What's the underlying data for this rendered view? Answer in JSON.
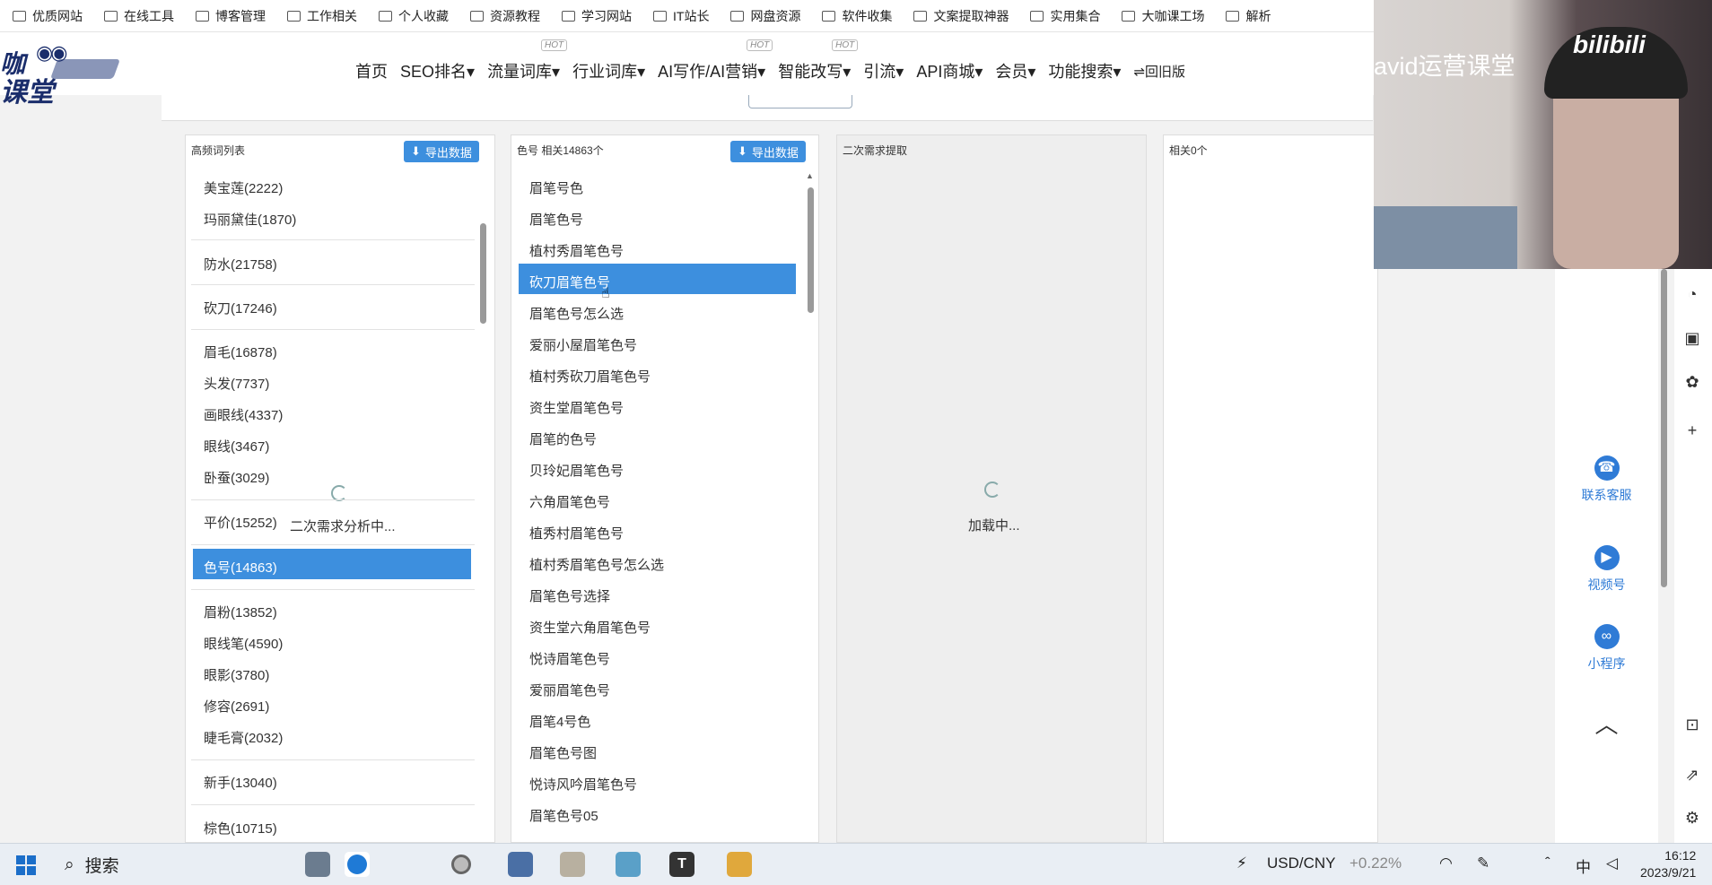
{
  "bookmarks": [
    "优质网站",
    "在线工具",
    "博客管理",
    "工作相关",
    "个人收藏",
    "资源教程",
    "学习网站",
    "IT站长",
    "网盘资源",
    "软件收集",
    "文案提取神器",
    "实用集合",
    "大咖课工场",
    "解析"
  ],
  "logo": {
    "line1": "咖",
    "line2": "课堂"
  },
  "nav": {
    "items": [
      "首页",
      "SEO排名▾",
      "流量词库▾",
      "行业词库▾",
      "AI写作/AI营销▾",
      "智能改写▾",
      "引流▾",
      "API商城▾",
      "会员▾",
      "功能搜索▾"
    ],
    "hot_label": "HOT",
    "old_version": "⇌回旧版"
  },
  "panel1": {
    "title": "高频词列表",
    "export": "导出数据",
    "items": [
      "美宝莲(2222)",
      "玛丽黛佳(1870)",
      "防水(21758)",
      "砍刀(17246)",
      "眉毛(16878)",
      "头发(7737)",
      "画眼线(4337)",
      "眼线(3467)",
      "卧蚕(3029)",
      "平价(15252)",
      "色号(14863)",
      "眉粉(13852)",
      "眼线笔(4590)",
      "眼影(3780)",
      "修容(2691)",
      "睫毛膏(2032)",
      "新手(13040)",
      "棕色(10715)"
    ],
    "selected": "色号(14863)",
    "analyzing": "二次需求分析中..."
  },
  "panel2": {
    "title": "色号 相关14863个",
    "export": "导出数据",
    "items": [
      "眉笔号色",
      "眉笔色号",
      "植村秀眉笔色号",
      "砍刀眉笔色号",
      "眉笔色号怎么选",
      "爱丽小屋眉笔色号",
      "植村秀砍刀眉笔色号",
      "资生堂眉笔色号",
      "眉笔的色号",
      "贝玲妃眉笔色号",
      "六角眉笔色号",
      "植秀村眉笔色号",
      "植村秀眉笔色号怎么选",
      "眉笔色号选择",
      "资生堂六角眉笔色号",
      "悦诗眉笔色号",
      "爱丽眉笔色号",
      "眉笔4号色",
      "眉笔色号图",
      "悦诗风吟眉笔色号",
      "眉笔色号05"
    ],
    "selected": "砍刀眉笔色号"
  },
  "panel3": {
    "title": "二次需求提取",
    "loading": "加载中..."
  },
  "panel4": {
    "title": "相关0个"
  },
  "video": {
    "title": "avid运营课堂",
    "brand": "bilibili"
  },
  "side": {
    "service": "联系客服",
    "channel": "视频号",
    "miniapp": "小程序"
  },
  "taskbar": {
    "search": "搜索",
    "currency": "USD/CNY",
    "change": "+0.22%",
    "ime": "中",
    "time": "16:12",
    "date": "2023/9/21"
  }
}
